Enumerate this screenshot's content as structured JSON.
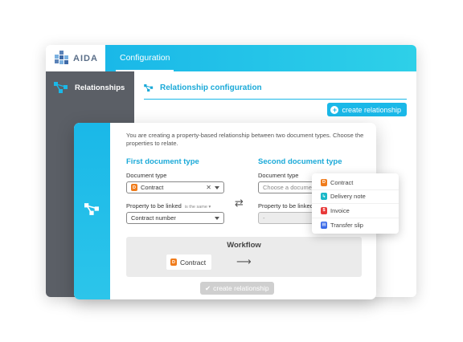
{
  "app": {
    "logo_text": "AIDA"
  },
  "topbar": {
    "active_tab": "Configuration"
  },
  "sidebar": {
    "items": [
      {
        "label": "Relationships",
        "icon": "relationship-icon"
      }
    ]
  },
  "main": {
    "section_title": "Relationship configuration",
    "create_button_label": "create relationship"
  },
  "dialog": {
    "intro": "You are creating a property-based relationship between two document types. Choose the properties to relate.",
    "first": {
      "title": "First document type",
      "doc_type_label": "Document type",
      "doc_type_value": "Contract",
      "property_label": "Property to be linked",
      "same_hint": "is the same",
      "property_value": "Contract number"
    },
    "second": {
      "title": "Second document type",
      "doc_type_label": "Document type",
      "doc_type_placeholder": "Choose a document type",
      "property_label": "Property to be linked",
      "property_value": "-"
    },
    "workflow": {
      "title": "Workflow",
      "chip_label": "Contract"
    },
    "create_button_label": "create relationship"
  },
  "dropdown": {
    "options": [
      {
        "label": "Contract",
        "color": "#f07c1c"
      },
      {
        "label": "Delivery note",
        "color": "#1ab8c8"
      },
      {
        "label": "Invoice",
        "color": "#e83a3a"
      },
      {
        "label": "Transfer slip",
        "color": "#3a6ae8"
      }
    ]
  }
}
